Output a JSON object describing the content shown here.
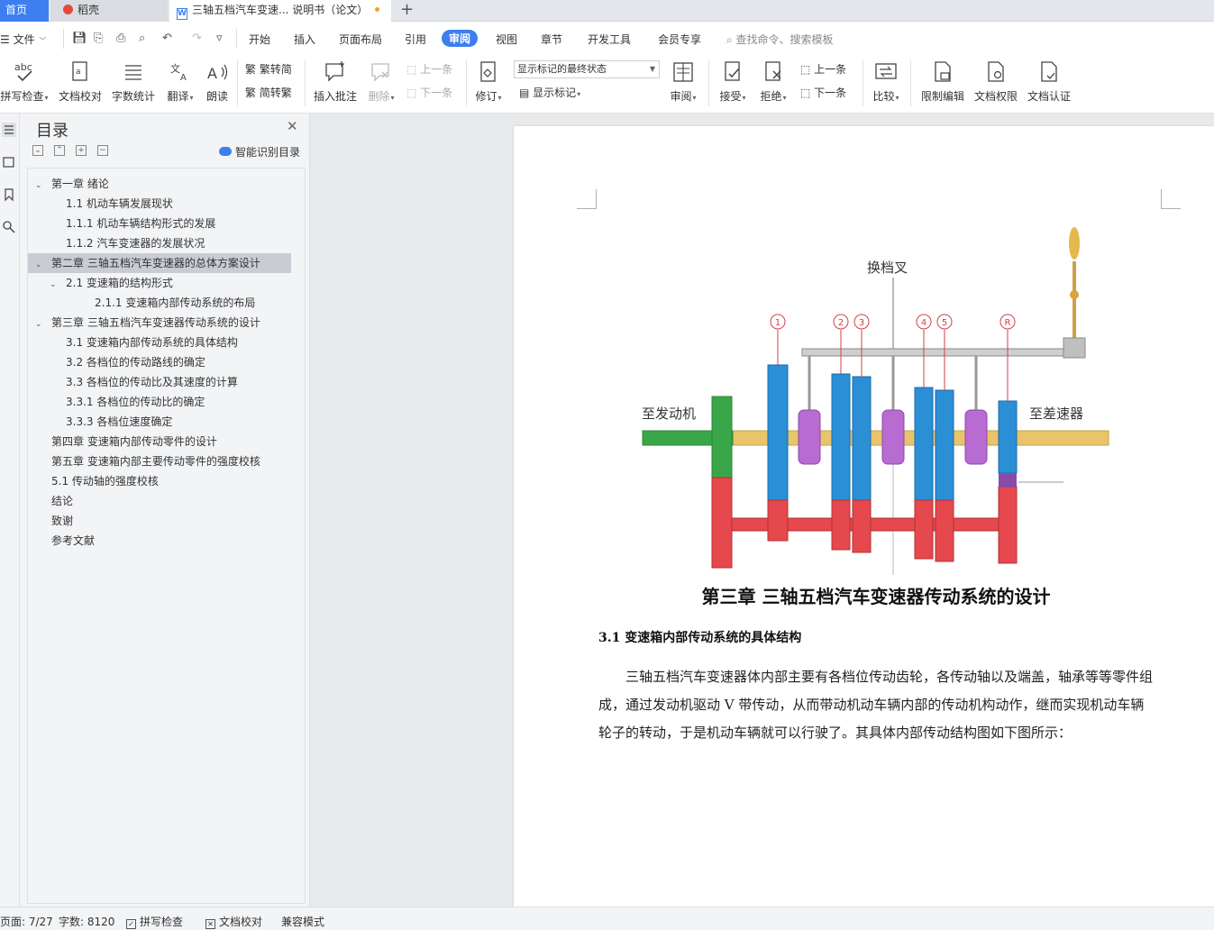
{
  "tabs": {
    "home": "首页",
    "straw": "稻壳",
    "doc_title": "三轴五档汽车变速... 说明书（论文）"
  },
  "menu": {
    "file": "文件",
    "tabs": [
      "开始",
      "插入",
      "页面布局",
      "引用",
      "审阅",
      "视图",
      "章节",
      "开发工具",
      "会员专享"
    ],
    "active_tab": "审阅",
    "search_placeholder": "查找命令、搜索模板"
  },
  "ribbon": {
    "spell_check": "拼写检查",
    "doc_proof": "文档校对",
    "word_count": "字数统计",
    "translate": "翻译",
    "read_aloud": "朗读",
    "trad_simp": "繁转简",
    "simp_trad": "简转繁",
    "insert_comment": "插入批注",
    "delete": "删除",
    "prev_comment": "上一条",
    "next_comment": "下一条",
    "track_changes": "修订",
    "markup_state": "显示标记的最终状态",
    "show_markup": "显示标记",
    "review": "审阅",
    "accept": "接受",
    "reject": "拒绝",
    "prev_change": "上一条",
    "next_change": "下一条",
    "compare": "比较",
    "restrict_edit": "限制编辑",
    "doc_permission": "文档权限",
    "doc_cert": "文档认证"
  },
  "toc": {
    "title": "目录",
    "smart_toc": "智能识别目录",
    "items": [
      {
        "label": "第一章  绪论",
        "level": 1,
        "expanded": true,
        "selected": false
      },
      {
        "label": "1.1  机动车辆发展现状",
        "level": 2,
        "selected": false
      },
      {
        "label": "1.1.1  机动车辆结构形式的发展",
        "level": 2,
        "selected": false
      },
      {
        "label": "1.1.2 汽车变速器的发展状况",
        "level": 2,
        "selected": false
      },
      {
        "label": "第二章  三轴五档汽车变速器的总体方案设计",
        "level": 1,
        "expanded": true,
        "selected": true
      },
      {
        "label": "2.1  变速箱的结构形式",
        "level": 2,
        "expanded": true,
        "selected": false
      },
      {
        "label": "2.1.1  变速箱内部传动系统的布局",
        "level": 3,
        "selected": false
      },
      {
        "label": "第三章  三轴五档汽车变速器传动系统的设计",
        "level": 1,
        "expanded": true,
        "selected": false
      },
      {
        "label": "3.1 变速箱内部传动系统的具体结构",
        "level": 2,
        "selected": false
      },
      {
        "label": "3.2 各档位的传动路线的确定",
        "level": 2,
        "selected": false
      },
      {
        "label": "3.3  各档位的传动比及其速度的计算",
        "level": 2,
        "selected": false
      },
      {
        "label": "3.3.1  各档位的传动比的确定",
        "level": 2,
        "selected": false
      },
      {
        "label": "3.3.3  各档位速度确定",
        "level": 2,
        "selected": false
      },
      {
        "label": "第四章  变速箱内部传动零件的设计",
        "level": 1,
        "selected": false
      },
      {
        "label": "第五章  变速箱内部主要传动零件的强度校核",
        "level": 1,
        "selected": false
      },
      {
        "label": "5.1 传动轴的强度校核",
        "level": 1,
        "selected": false
      },
      {
        "label": "结论",
        "level": 1,
        "selected": false
      },
      {
        "label": "致谢",
        "level": 1,
        "selected": false
      },
      {
        "label": "参考文献",
        "level": 1,
        "selected": false
      }
    ]
  },
  "document": {
    "figure_labels": {
      "shift_fork": "换档叉",
      "to_engine": "至发动机",
      "to_differential": "至差速器",
      "gears": [
        "1",
        "2",
        "3",
        "4",
        "5",
        "R"
      ]
    },
    "chapter_title": "第三章  三轴五档汽车变速器传动系统的设计",
    "section_title": "3.1 变速箱内部传动系统的具体结构",
    "paragraph": "三轴五档汽车变速器体内部主要有各档位传动齿轮，各传动轴以及端盖，轴承等等零件组成，通过发动机驱动 V 带传动，从而带动机动车辆内部的传动机构动作，继而实现机动车辆轮子的转动，于是机动车辆就可以行驶了。其具体内部传动结构图如下图所示："
  },
  "status": {
    "page": "页面: 7/27",
    "words": "字数: 8120",
    "spell_check": "拼写检查",
    "doc_proof": "文档校对",
    "compat_mode": "兼容模式"
  },
  "colors": {
    "accent": "#3d7ff0",
    "gear_blue": "#2b8fd6",
    "gear_red": "#e5484d",
    "gear_green": "#3aa64a",
    "sleeve_purple": "#b86bd0",
    "shaft_gold": "#e8c46a"
  }
}
